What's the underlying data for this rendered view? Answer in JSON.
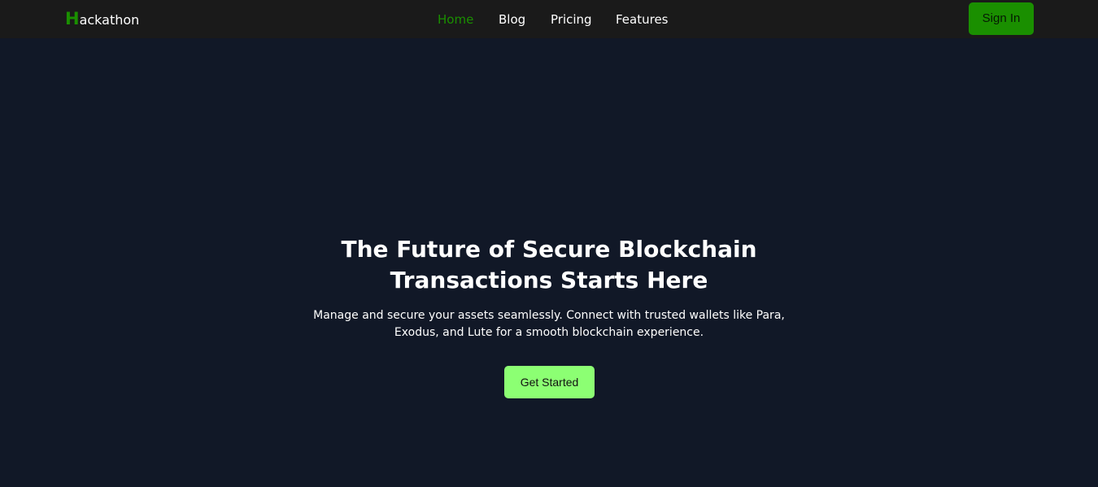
{
  "brand": {
    "first_letter": "H",
    "rest": "ackathon"
  },
  "nav": {
    "items": [
      {
        "label": "Home",
        "active": true
      },
      {
        "label": "Blog",
        "active": false
      },
      {
        "label": "Pricing",
        "active": false
      },
      {
        "label": "Features",
        "active": false
      }
    ],
    "signin_label": "Sign In"
  },
  "hero": {
    "title_line1": "The Future of Secure Blockchain",
    "title_line2": "Transactions Starts Here",
    "subtitle_line1": "Manage and secure your assets seamlessly. Connect with trusted wallets like Para,",
    "subtitle_line2": "Exodus, and Lute for a smooth blockchain experience.",
    "cta_label": "Get Started"
  },
  "colors": {
    "page_bg": "#111827",
    "navbar_bg": "#1a1a1a",
    "brand_green": "#1a8f00",
    "cta_green": "#8cff73",
    "text": "#ffffff"
  }
}
